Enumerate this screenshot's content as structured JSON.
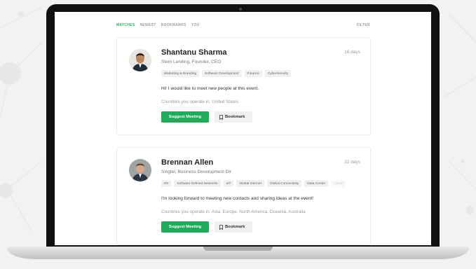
{
  "tabs": [
    {
      "label": "MATCHES",
      "active": true
    },
    {
      "label": "NEWEST",
      "active": false
    },
    {
      "label": "BOOKMARKS",
      "active": false
    },
    {
      "label": "YOU",
      "active": false
    }
  ],
  "filter_label": "FILTER",
  "cards": [
    {
      "name": "Shantanu Sharma",
      "subtitle": "Stem Lending, Founder, CEO",
      "days": "16 days",
      "tags": [
        "Marketing & Branding",
        "Software Development",
        "Finance",
        "Cybersecurity"
      ],
      "message": "Hi! I would like to meet new people at this event.",
      "countries": "Countries you operate in: United States",
      "suggest_label": "Suggest Meeting",
      "bookmark_label": "Bookmark"
    },
    {
      "name": "Brennan Allen",
      "subtitle": "Singtel, Business Development Dir",
      "days": "22 days",
      "tags": [
        "5G",
        "Software Defined Networks",
        "IoT",
        "Global Internet",
        "Global Connectivity",
        "Data Center",
        "Cloud"
      ],
      "message": "I'm looking forward to meeting new contacts and sharing ideas at the event!",
      "countries": "Countries you operate in: Asia, Europe, North America, Oceania, Australia",
      "suggest_label": "Suggest Meeting",
      "bookmark_label": "Bookmark"
    }
  ],
  "colors": {
    "accent_green": "#1fab5a",
    "tab_active": "#2eae60",
    "bezel": "#111111",
    "background": "#f1f2f3"
  }
}
